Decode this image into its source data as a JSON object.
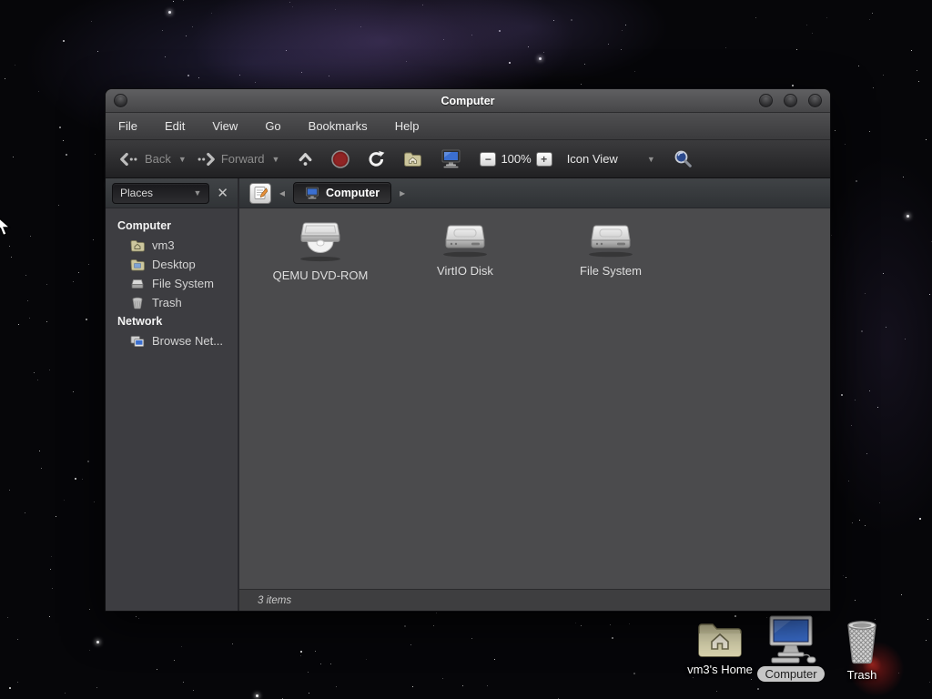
{
  "window": {
    "title": "Computer",
    "menu_items": [
      "File",
      "Edit",
      "View",
      "Go",
      "Bookmarks",
      "Help"
    ],
    "toolbar": {
      "back": "Back",
      "forward": "Forward",
      "zoom_level": "100%",
      "view_mode": "Icon View"
    },
    "pathbar": {
      "location": "Computer"
    },
    "sidebar": {
      "filter_label": "Places",
      "section1_header": "Computer",
      "section1_items": [
        {
          "label": "vm3",
          "icon": "folder-home-icon"
        },
        {
          "label": "Desktop",
          "icon": "folder-desktop-icon"
        },
        {
          "label": "File System",
          "icon": "drive-icon"
        },
        {
          "label": "Trash",
          "icon": "trash-icon"
        }
      ],
      "section2_header": "Network",
      "section2_items": [
        {
          "label": "Browse Net...",
          "icon": "network-icon"
        }
      ]
    },
    "files": [
      {
        "label": "QEMU DVD-ROM",
        "icon": "optical-drive-icon"
      },
      {
        "label": "VirtIO Disk",
        "icon": "hard-drive-icon"
      },
      {
        "label": "File System",
        "icon": "hard-drive-icon"
      }
    ],
    "status": "3 items"
  },
  "desktop_icons": [
    {
      "label": "vm3's Home",
      "icon": "folder-home-icon",
      "selected": false
    },
    {
      "label": "Computer",
      "icon": "computer-icon",
      "selected": true
    },
    {
      "label": "Trash",
      "icon": "trash-basket-icon",
      "selected": false
    }
  ],
  "colors": {
    "screen_blue": "#3b6fd0",
    "stop_red": "#8b2020",
    "folder_beige": "#d6d1a8",
    "selected_label_pill": "#c7c7c7",
    "window_content_bg": "#4b4b4d",
    "sidebar_bg": "#3d3d41"
  }
}
